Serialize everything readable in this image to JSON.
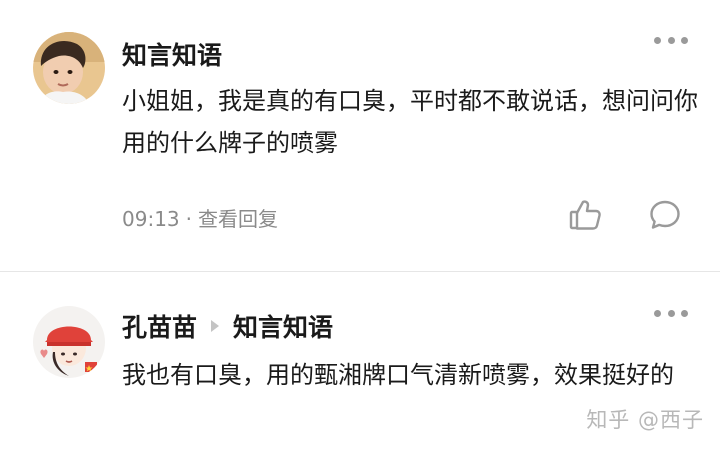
{
  "comments": [
    {
      "author": "知言知语",
      "text": "小姐姐，我是真的有口臭，平时都不敢说话，想问问你用的什么牌子的喷雾",
      "time": "09:13",
      "separator": "·",
      "reply_label": "查看回复",
      "avatar_icon": "child-portrait-avatar",
      "like_icon": "thumbs-up-icon",
      "comment_icon": "comment-bubble-icon",
      "more_icon": "more-dots-icon"
    },
    {
      "author": "孔苗苗",
      "reply_to": "知言知语",
      "text": "我也有口臭，用的甄湘牌口气清新喷雾，效果挺好的",
      "avatar_icon": "cartoon-helmet-avatar",
      "more_icon": "more-dots-icon"
    }
  ],
  "watermark": "知乎 @西子",
  "colors": {
    "text": "#1a1a1a",
    "meta": "#8a8a8a",
    "icon": "#9a9a9a",
    "divider": "#e6e6e6",
    "watermark": "#b8b8b8"
  }
}
